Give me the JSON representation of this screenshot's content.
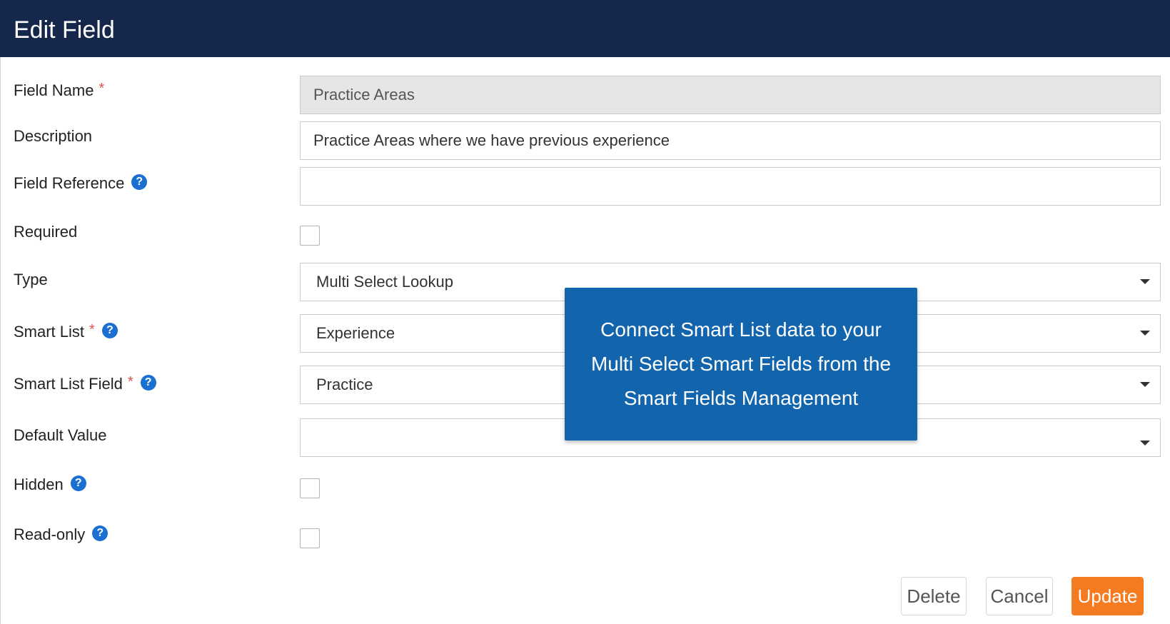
{
  "dialog": {
    "title": "Edit Field"
  },
  "fields": {
    "field_name": {
      "label": "Field Name",
      "required_mark": "*",
      "value": "Practice Areas"
    },
    "description": {
      "label": "Description",
      "value": "Practice Areas where we have previous experience"
    },
    "field_reference": {
      "label": "Field Reference",
      "value": ""
    },
    "required": {
      "label": "Required",
      "checked": false
    },
    "type": {
      "label": "Type",
      "value": "Multi Select Lookup"
    },
    "smart_list": {
      "label": "Smart List",
      "required_mark": "*",
      "value": "Experience"
    },
    "smart_list_field": {
      "label": "Smart List Field",
      "required_mark": "*",
      "value": "Practice"
    },
    "default_value": {
      "label": "Default Value",
      "value": ""
    },
    "hidden": {
      "label": "Hidden",
      "checked": false
    },
    "read_only": {
      "label": "Read-only",
      "checked": false
    }
  },
  "help_icon_glyph": "?",
  "tooltip": {
    "text": "Connect Smart List data to your Multi Select Smart Fields from the Smart Fields Management"
  },
  "buttons": {
    "delete": "Delete",
    "cancel": "Cancel",
    "update": "Update"
  },
  "colors": {
    "header_bg": "#15284b",
    "tooltip_bg": "#1264ad",
    "primary_button": "#f47b20",
    "help_icon": "#1a6fd1",
    "required_mark": "#d9534f"
  }
}
